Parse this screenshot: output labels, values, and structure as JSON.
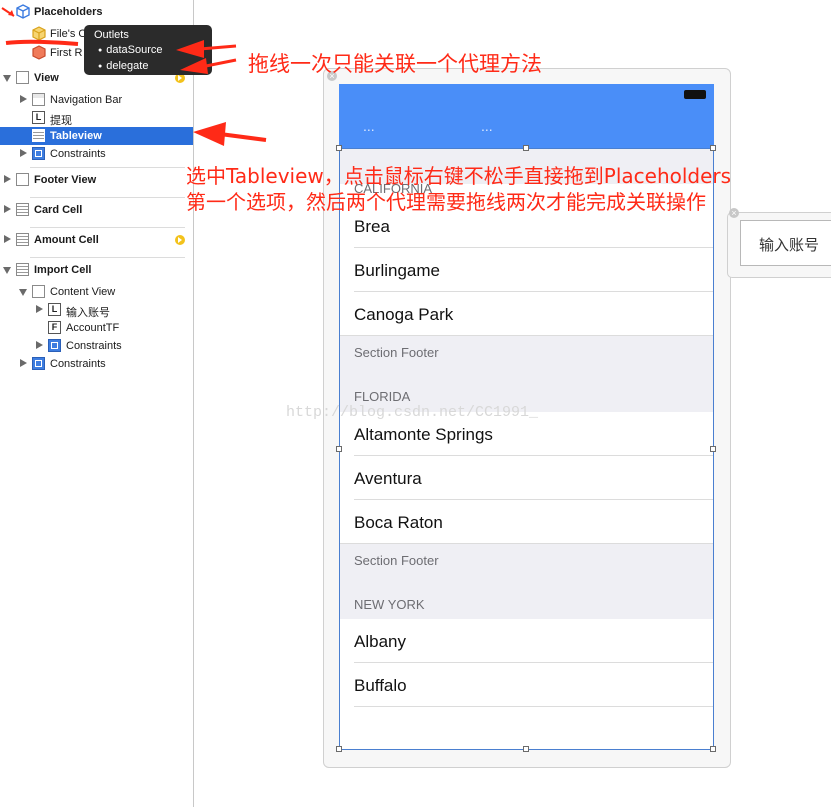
{
  "colors": {
    "accent_blue": "#2a6fdb",
    "annotation_red": "#ff2a17",
    "navbar_blue": "#4a8ef8"
  },
  "outline": {
    "placeholders_label": "Placeholders",
    "files_owner_label": "File's O",
    "first_responder_label": "First R",
    "items": [
      {
        "label": "View"
      },
      {
        "label": "Navigation Bar"
      },
      {
        "label": "提现"
      },
      {
        "label": "Tableview"
      },
      {
        "label": "Constraints"
      },
      {
        "label": "Footer View"
      },
      {
        "label": "Card Cell"
      },
      {
        "label": "Amount Cell"
      },
      {
        "label": "Import Cell"
      },
      {
        "label": "Content View"
      },
      {
        "label": "输入账号"
      },
      {
        "label": "AccountTF"
      },
      {
        "label": "Constraints"
      },
      {
        "label": "Constraints"
      }
    ]
  },
  "outlets_popup": {
    "title": "Outlets",
    "items": [
      "dataSource",
      "delegate"
    ]
  },
  "navbar": {
    "left_item": "...",
    "title_item": "..."
  },
  "table": {
    "sections": [
      {
        "header": "CALIFORNIA",
        "rows": [
          "Brea",
          "Burlingame",
          "Canoga Park"
        ],
        "footer": "Section Footer"
      },
      {
        "header": "FLORIDA",
        "rows": [
          "Altamonte Springs",
          "Aventura",
          "Boca Raton"
        ],
        "footer": "Section Footer"
      },
      {
        "header": "NEW YORK",
        "rows": [
          "Albany",
          "Buffalo"
        ]
      }
    ]
  },
  "side_scene": {
    "text": "输入账号"
  },
  "annotations": {
    "top": "拖线一次只能关联一个代理方法",
    "line1": "选中Tableview，点击鼠标右键不松手直接拖到Placeholders",
    "line2": "第一个选项，然后两个代理需要拖线两次才能完成关联操作"
  },
  "watermark": "http://blog.csdn.net/CC1991_"
}
